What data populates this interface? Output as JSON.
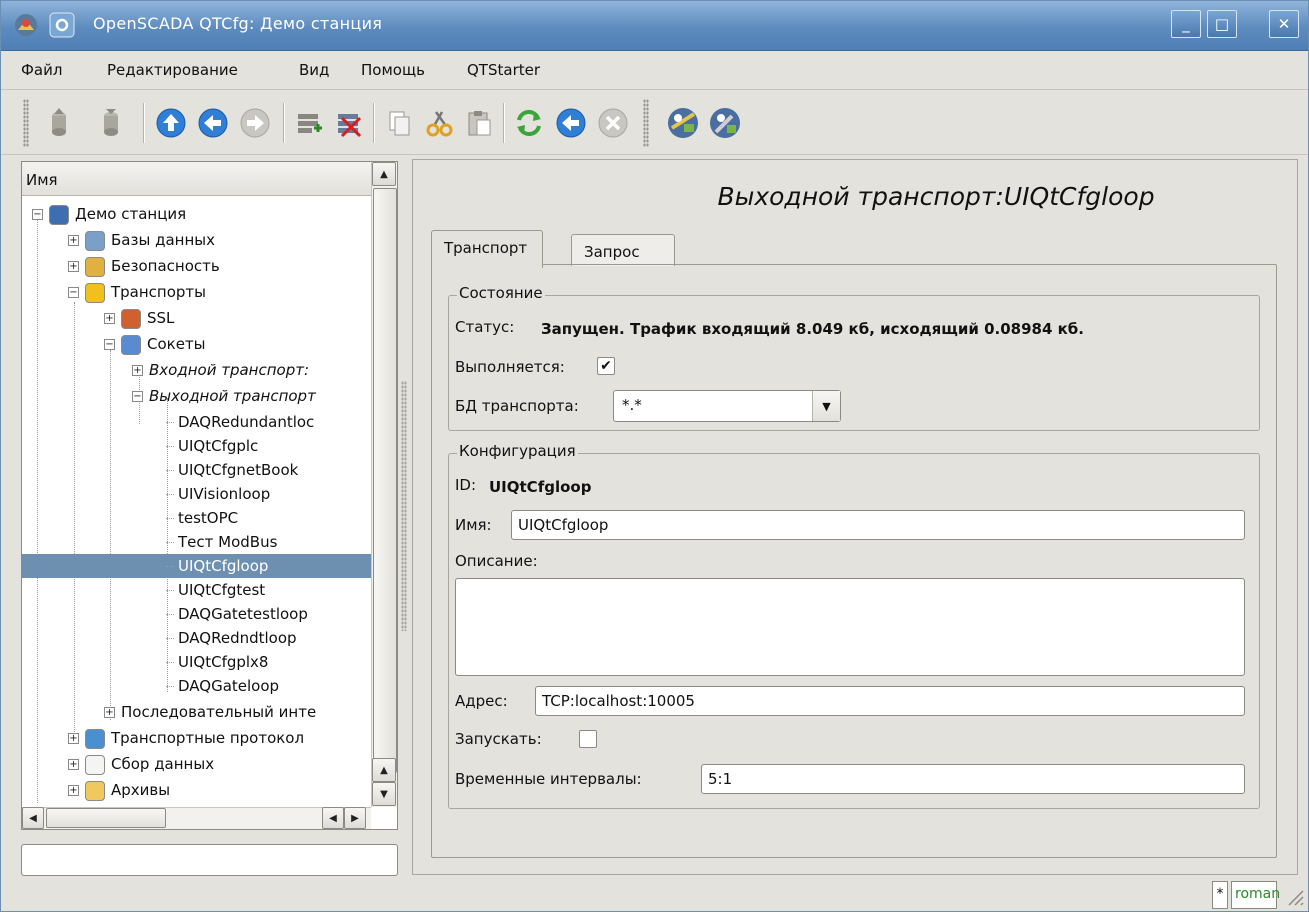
{
  "window": {
    "title": "OpenSCADA QTCfg: Демо станция",
    "minimize_label": "_",
    "maximize_label": "□",
    "close_label": "✕"
  },
  "menu": {
    "items": [
      {
        "label": "Файл"
      },
      {
        "label": "Редактирование"
      },
      {
        "label": "Вид"
      },
      {
        "label": "Помощь"
      },
      {
        "label": "QTStarter"
      }
    ]
  },
  "toolbar": {
    "icons": [
      "db-load-icon",
      "db-save-icon",
      "up-icon",
      "back-icon",
      "forward-icon",
      "add-item-icon",
      "delete-item-icon",
      "copy-icon",
      "cut-icon",
      "paste-icon",
      "refresh-icon",
      "start-icon",
      "stop-icon",
      "remote-station-icon",
      "config-icon"
    ]
  },
  "tree": {
    "header": "Имя",
    "nodes": [
      {
        "label": "Демо станция",
        "expander": "−",
        "italic": false
      },
      {
        "label": "Базы данных",
        "expander": "+",
        "italic": false
      },
      {
        "label": "Безопасность",
        "expander": "+",
        "italic": false
      },
      {
        "label": "Транспорты",
        "expander": "−",
        "italic": false
      },
      {
        "label": "SSL",
        "expander": "+",
        "italic": false
      },
      {
        "label": "Сокеты",
        "expander": "−",
        "italic": false
      },
      {
        "label": "Входной транспорт:",
        "expander": "+",
        "italic": true
      },
      {
        "label": "Выходной транспорт",
        "expander": "−",
        "italic": true
      },
      {
        "label": "DAQRedundantloc",
        "expander": "",
        "italic": false
      },
      {
        "label": "UIQtCfgplc",
        "expander": "",
        "italic": false
      },
      {
        "label": "UIQtCfgnetBook",
        "expander": "",
        "italic": false
      },
      {
        "label": "UIVisionloop",
        "expander": "",
        "italic": false
      },
      {
        "label": "testOPC",
        "expander": "",
        "italic": false
      },
      {
        "label": "Тест ModBus",
        "expander": "",
        "italic": false
      },
      {
        "label": "UIQtCfgloop",
        "expander": "",
        "italic": false,
        "selected": true
      },
      {
        "label": "UIQtCfgtest",
        "expander": "",
        "italic": false
      },
      {
        "label": "DAQGatetestloop",
        "expander": "",
        "italic": false
      },
      {
        "label": "DAQRedndtloop",
        "expander": "",
        "italic": false
      },
      {
        "label": "UIQtCfgplx8",
        "expander": "",
        "italic": false
      },
      {
        "label": "DAQGateloop",
        "expander": "",
        "italic": false
      },
      {
        "label": "Последовательный инте",
        "expander": "+",
        "italic": false
      },
      {
        "label": "Транспортные протокол",
        "expander": "+",
        "italic": false
      },
      {
        "label": "Сбор данных",
        "expander": "+",
        "italic": false
      },
      {
        "label": "Архивы",
        "expander": "+",
        "italic": false
      }
    ]
  },
  "main": {
    "title": "Выходной транспорт:UIQtCfgloop",
    "tabs": [
      {
        "label": "Транспорт",
        "active": true
      },
      {
        "label": "Запрос",
        "active": false
      }
    ],
    "state_group": {
      "title": "Состояние",
      "status_label": "Статус:",
      "status_value": "Запущен. Трафик входящий 8.049 кб, исходящий 0.08984 кб.",
      "running_label": "Выполняется:",
      "running_checked": true,
      "db_label": "БД транспорта:",
      "db_value": "*.*"
    },
    "config_group": {
      "title": "Конфигурация",
      "id_label": "ID:",
      "id_value": "UIQtCfgloop",
      "name_label": "Имя:",
      "name_value": "UIQtCfgloop",
      "description_label": "Описание:",
      "description_value": "",
      "address_label": "Адрес:",
      "address_value": "TCP:localhost:10005",
      "start_label": "Запускать:",
      "start_checked": false,
      "timeouts_label": "Временные интервалы:",
      "timeouts_value": "5:1"
    }
  },
  "statusbar": {
    "modified_flag": "*",
    "user": "roman"
  },
  "colors": {
    "titlebar": "#5d8bbf",
    "selection": "#6d8fb0",
    "user_badge_text": "#2a8a2a"
  }
}
